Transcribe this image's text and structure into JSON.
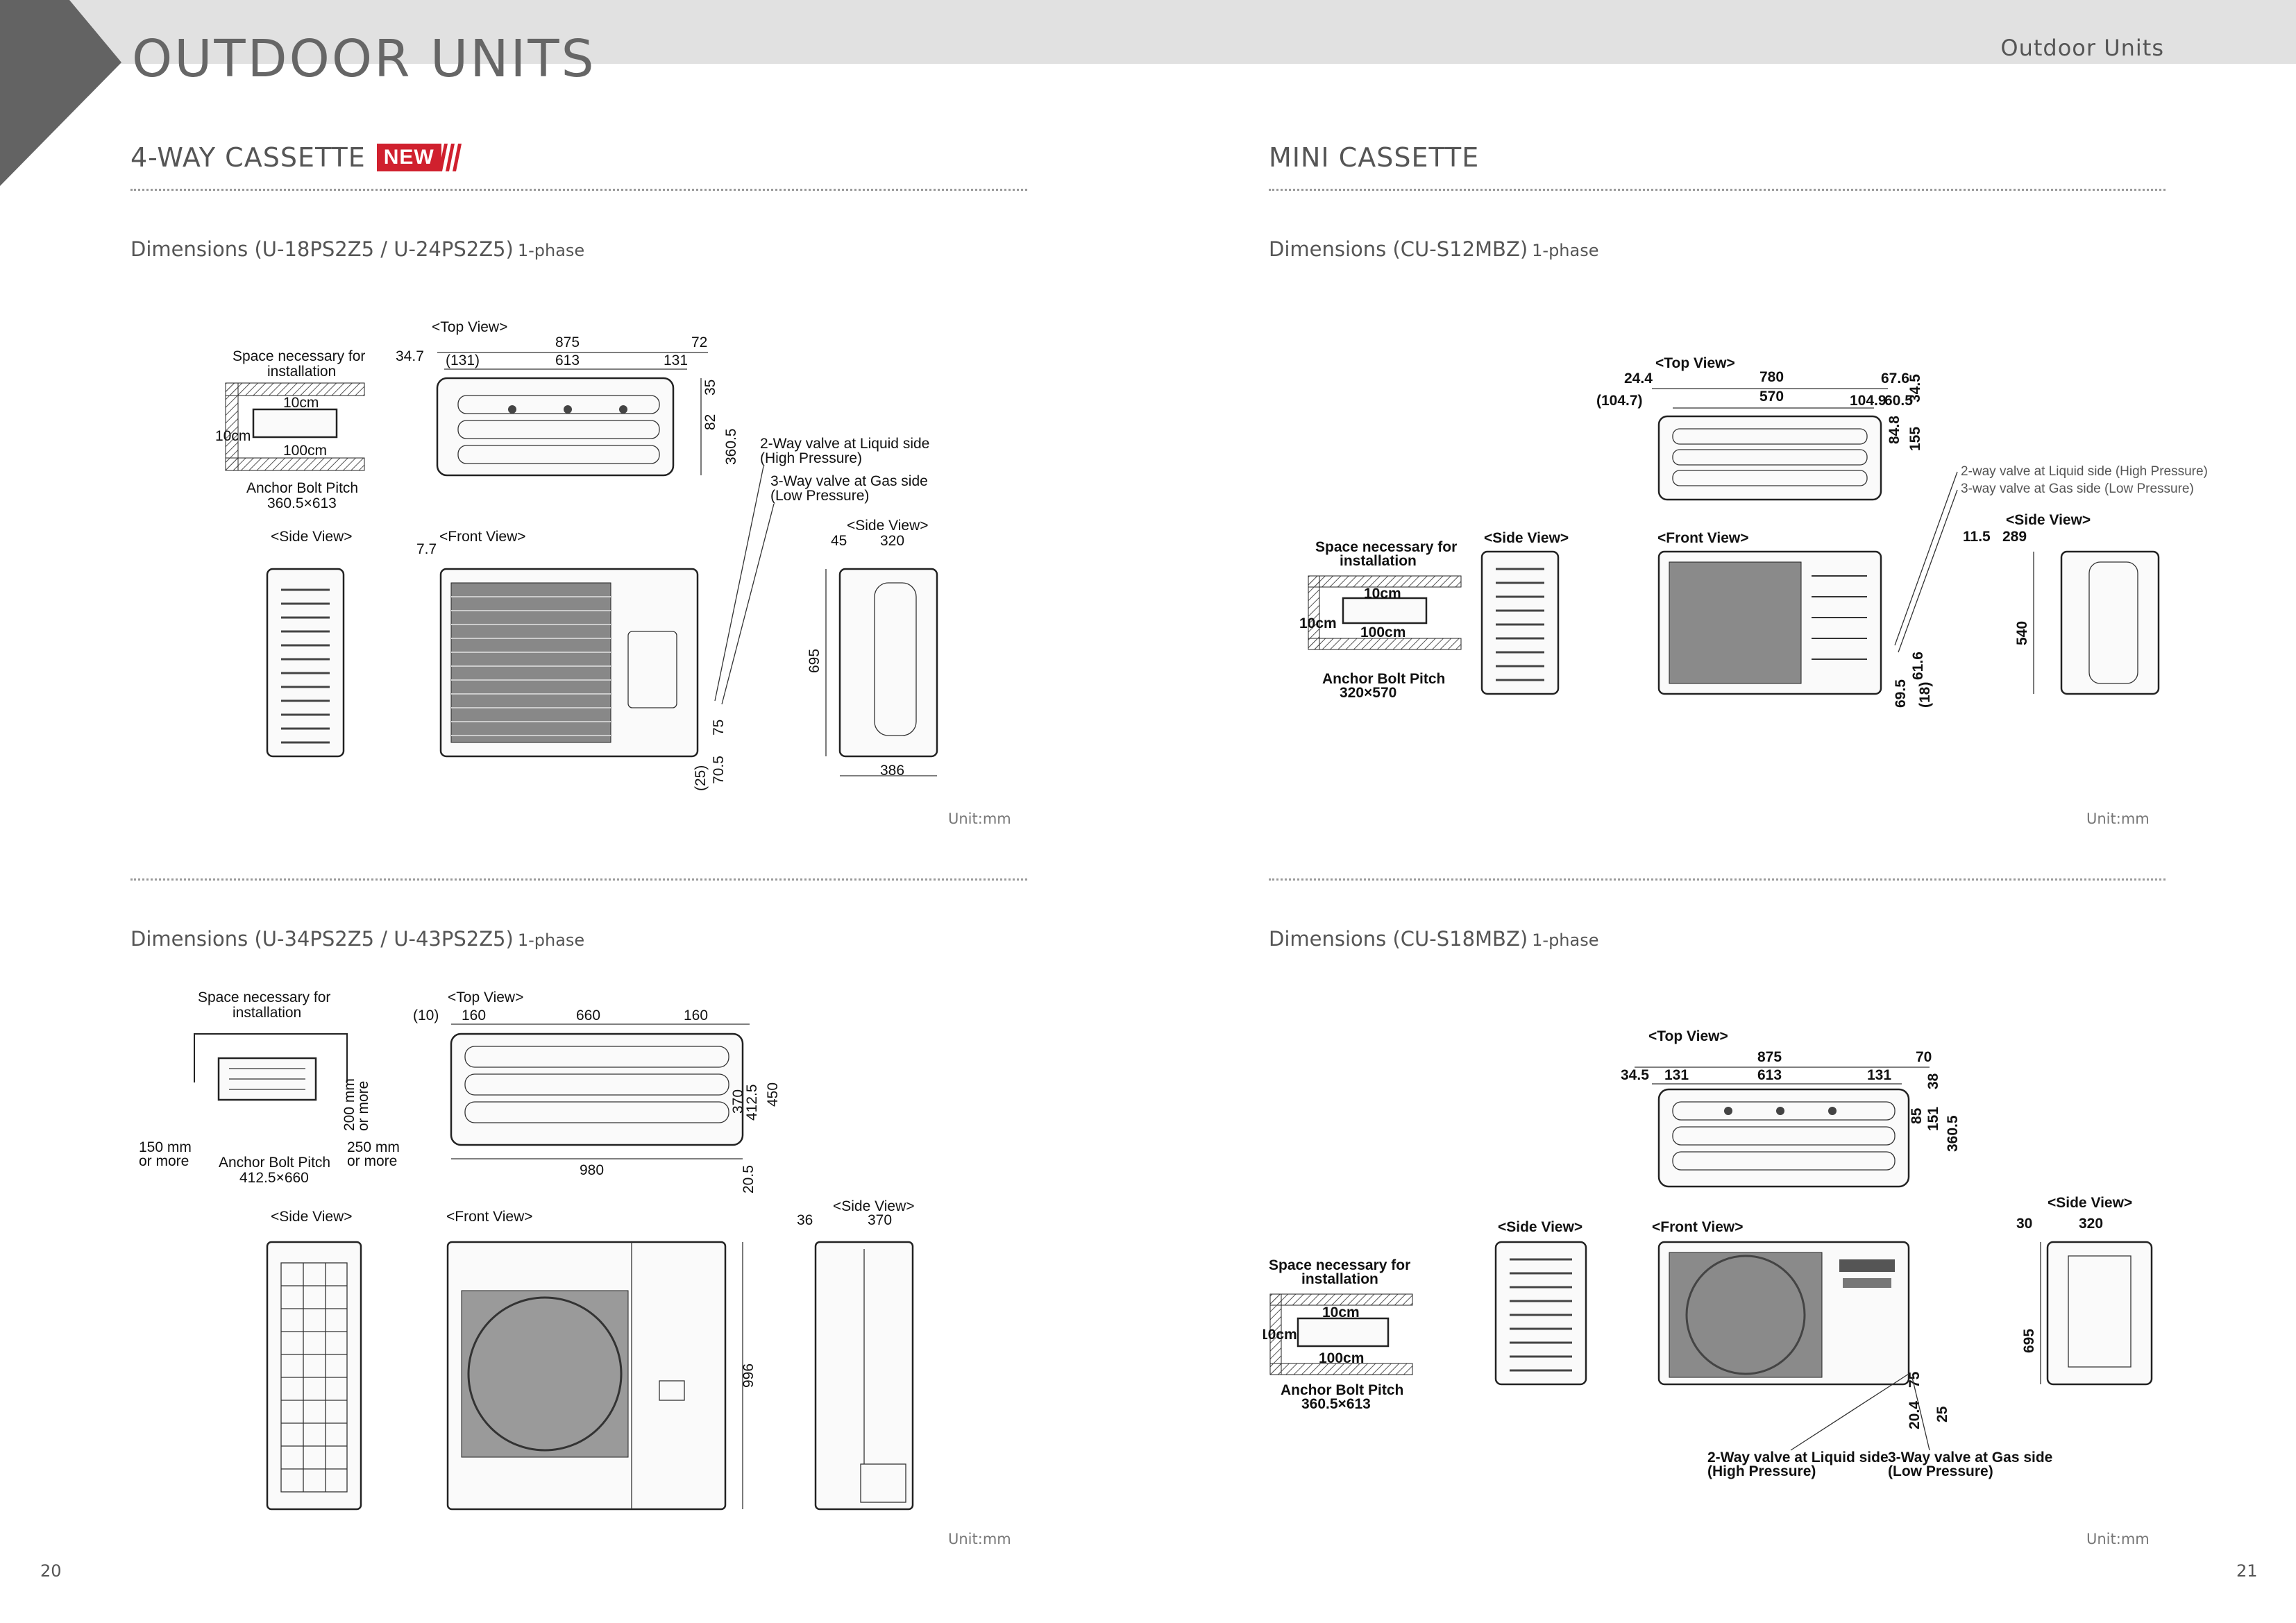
{
  "header": {
    "title": "OUTDOOR UNITS",
    "section": "Outdoor Units"
  },
  "left": {
    "title": "4-WAY CASSETTE",
    "badge": "NEW",
    "block1": {
      "heading": "Dimensions (U-18PS2Z5 / U-24PS2Z5)",
      "phase": "1-phase",
      "unit": "Unit:mm",
      "labels": {
        "top_view": "<Top View>",
        "space1": "Space necessary for",
        "space2": "installation",
        "cm10a": "10cm",
        "cm10b": "10cm",
        "cm100": "100cm",
        "anchor1": "Anchor Bolt Pitch",
        "anchor2": "360.5×613",
        "side_view_left": "<Side View>",
        "front_view": "<Front View>",
        "side_view_right": "<Side View>",
        "valve1a": "2-Way valve at Liquid side",
        "valve1b": "(High Pressure)",
        "valve2a": "3-Way valve at Gas side",
        "valve2b": "(Low Pressure)",
        "d875": "875",
        "d72": "72",
        "d347": "34.7",
        "d131p": "(131)",
        "d613": "613",
        "d131": "131",
        "d35": "35",
        "d82": "82",
        "d3605": "360.5",
        "d77": "7.7",
        "d45": "45",
        "d320": "320",
        "d695": "695",
        "d386": "386",
        "d75": "75",
        "d705": "70.5",
        "d25p": "(25)"
      }
    },
    "block2": {
      "heading": "Dimensions (U-34PS2Z5 / U-43PS2Z5)",
      "phase": "1-phase",
      "unit": "Unit:mm",
      "labels": {
        "space1": "Space necessary for",
        "space2": "installation",
        "top_view": "<Top View>",
        "mm200a": "200 mm",
        "mm200b": "or more",
        "mm150a": "150 mm",
        "mm150b": "or more",
        "mm250a": "250 mm",
        "mm250b": "or more",
        "anchor1": "Anchor Bolt Pitch",
        "anchor2": "412.5×660",
        "side_view_left": "<Side View>",
        "front_view": "<Front View>",
        "side_view_right": "<Side View>",
        "d10p": "(10)",
        "d160a": "160",
        "d660": "660",
        "d160b": "160",
        "d370": "370",
        "d4125": "412.5",
        "d450": "450",
        "d980": "980",
        "d205": "20.5",
        "d36": "36",
        "d370b": "370",
        "d996": "996"
      }
    }
  },
  "right": {
    "title": "MINI CASSETTE",
    "block1": {
      "heading": "Dimensions (CU-S12MBZ)",
      "phase": "1-phase",
      "unit": "Unit:mm",
      "labels": {
        "top_view": "<Top View>",
        "d244": "24.4",
        "d780": "780",
        "d676": "67.6",
        "d345": "34.5",
        "d1047p": "(104.7)",
        "d570": "570",
        "d1049": "104.9",
        "d605": "60.5",
        "d848": "84.8",
        "d155": "155",
        "valve1": "2-way valve at Liquid side (High Pressure)",
        "valve2": "3-way valve at Gas side (Low Pressure)",
        "side_view_right": "<Side View>",
        "d115": "11.5",
        "d289": "289",
        "d540": "540",
        "space1": "Space necessary for",
        "space2": "installation",
        "side_view_left": "<Side View>",
        "front_view": "<Front View>",
        "cm10a": "10cm",
        "cm10b": "10cm",
        "cm100": "100cm",
        "anchor1": "Anchor Bolt Pitch",
        "anchor2": "320×570",
        "d616": "61.6",
        "d695": "69.5",
        "d18p": "(18)"
      }
    },
    "block2": {
      "heading": "Dimensions (CU-S18MBZ)",
      "phase": "1-phase",
      "unit": "Unit:mm",
      "labels": {
        "top_view": "<Top View>",
        "d875": "875",
        "d70": "70",
        "d345": "34.5",
        "d131a": "131",
        "d613": "613",
        "d131b": "131",
        "d38": "38",
        "d85": "85",
        "d151": "151",
        "d3605": "360.5",
        "side_view_right": "<Side View>",
        "side_view_left": "<Side View>",
        "front_view": "<Front View>",
        "d30": "30",
        "d320": "320",
        "d695": "695",
        "space1": "Space necessary for",
        "space2": "installation",
        "cm10a": "10cm",
        "cm10b": "10cm",
        "cm100": "100cm",
        "anchor1": "Anchor Bolt Pitch",
        "anchor2": "360.5×613",
        "d204": "20.4",
        "d75": "75",
        "d25": "25",
        "valve1a": "2-Way valve at Liquid side",
        "valve1b": "(High Pressure)",
        "valve2a": "3-Way valve at Gas side",
        "valve2b": "(Low Pressure)"
      }
    }
  },
  "footer": {
    "page_left": "20",
    "page_right": "21"
  }
}
